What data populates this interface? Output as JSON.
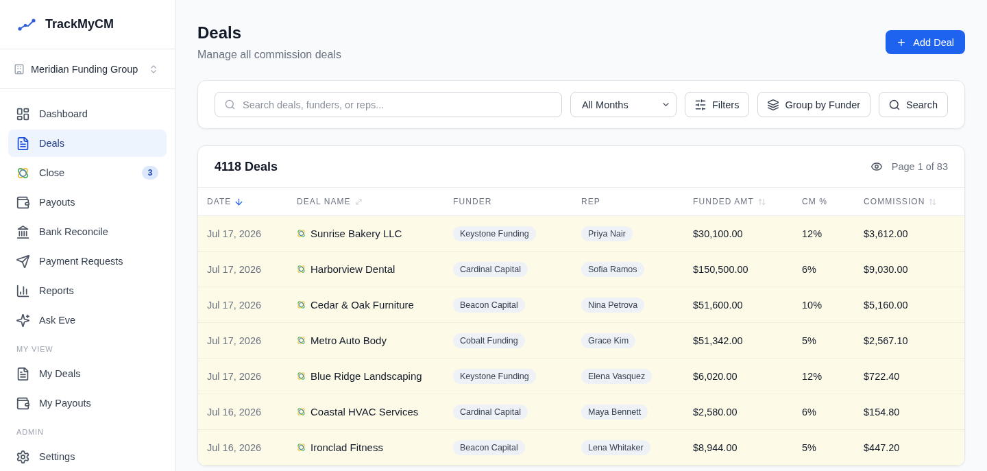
{
  "sidebar": {
    "brand": "TrackMyCM",
    "workspace": "Meridian Funding Group",
    "sections": [
      {
        "items": [
          {
            "label": "Dashboard",
            "selected": false
          },
          {
            "label": "Deals",
            "selected": true
          },
          {
            "label": "Close",
            "selected": false,
            "badge": "3"
          },
          {
            "label": "Payouts",
            "selected": false
          },
          {
            "label": "Bank Reconcile",
            "selected": false
          },
          {
            "label": "Payment Requests",
            "selected": false
          },
          {
            "label": "Reports",
            "selected": false
          },
          {
            "label": "Ask Eve",
            "selected": false
          }
        ]
      },
      {
        "title": "MY VIEW",
        "items": [
          {
            "label": "My Deals",
            "selected": false
          },
          {
            "label": "My Payouts",
            "selected": false
          }
        ]
      },
      {
        "title": "ADMIN",
        "items": [
          {
            "label": "Settings",
            "selected": false
          }
        ]
      }
    ]
  },
  "header": {
    "title": "Deals",
    "subtitle": "Manage all commission deals",
    "action": "Add Deal"
  },
  "filters": {
    "search": {
      "placeholder": "Search deals, funders, or reps..."
    },
    "month": {
      "value": "All Months"
    },
    "buttons": [
      "Filters",
      "Group by Funder",
      "Search"
    ]
  },
  "table": {
    "title": "4118 Deals",
    "pagination": "Page 1 of 83",
    "columns": [
      {
        "label": "DATE",
        "sorted": true,
        "sortable": false,
        "expandable": false
      },
      {
        "label": "DEAL NAME",
        "sorted": false,
        "sortable": false,
        "expandable": true
      },
      {
        "label": "FUNDER",
        "sorted": false,
        "sortable": false,
        "expandable": false
      },
      {
        "label": "REP",
        "sorted": false,
        "sortable": false,
        "expandable": false
      },
      {
        "label": "FUNDED AMT",
        "sorted": false,
        "sortable": true,
        "expandable": false
      },
      {
        "label": "CM %",
        "sorted": false,
        "sortable": false,
        "expandable": false
      },
      {
        "label": "COMMISSION",
        "sorted": false,
        "sortable": true,
        "expandable": false
      }
    ],
    "rows": [
      {
        "date": "Jul 17, 2026",
        "deal": "Sunrise Bakery LLC",
        "funder": "Keystone Funding",
        "rep": "Priya Nair",
        "funded": "$30,100.00",
        "cm": "12%",
        "commission": "$3,612.00"
      },
      {
        "date": "Jul 17, 2026",
        "deal": "Harborview Dental",
        "funder": "Cardinal Capital",
        "rep": "Sofia Ramos",
        "funded": "$150,500.00",
        "cm": "6%",
        "commission": "$9,030.00"
      },
      {
        "date": "Jul 17, 2026",
        "deal": "Cedar & Oak Furniture",
        "funder": "Beacon Capital",
        "rep": "Nina Petrova",
        "funded": "$51,600.00",
        "cm": "10%",
        "commission": "$5,160.00"
      },
      {
        "date": "Jul 17, 2026",
        "deal": "Metro Auto Body",
        "funder": "Cobalt Funding",
        "rep": "Grace Kim",
        "funded": "$51,342.00",
        "cm": "5%",
        "commission": "$2,567.10"
      },
      {
        "date": "Jul 17, 2026",
        "deal": "Blue Ridge Landscaping",
        "funder": "Keystone Funding",
        "rep": "Elena Vasquez",
        "funded": "$6,020.00",
        "cm": "12%",
        "commission": "$722.40"
      },
      {
        "date": "Jul 16, 2026",
        "deal": "Coastal HVAC Services",
        "funder": "Cardinal Capital",
        "rep": "Maya Bennett",
        "funded": "$2,580.00",
        "cm": "6%",
        "commission": "$154.80"
      },
      {
        "date": "Jul 16, 2026",
        "deal": "Ironclad Fitness",
        "funder": "Beacon Capital",
        "rep": "Lena Whitaker",
        "funded": "$8,944.00",
        "cm": "5%",
        "commission": "$447.20"
      }
    ]
  }
}
